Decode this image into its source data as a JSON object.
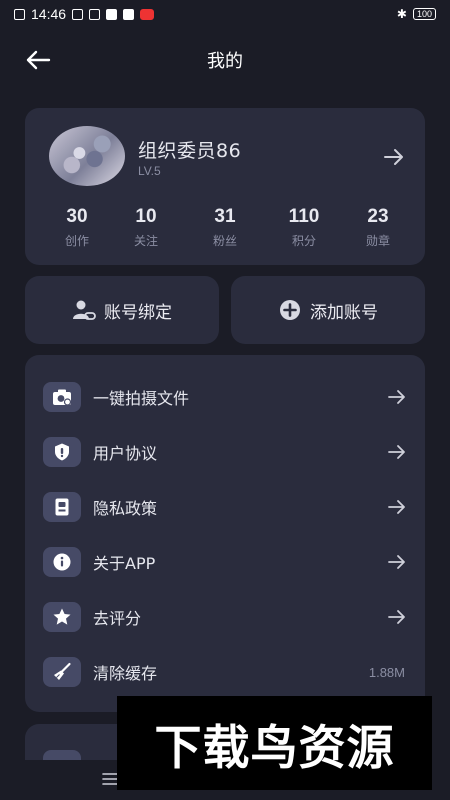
{
  "status_bar": {
    "time": "14:46",
    "battery": "100"
  },
  "header": {
    "title": "我的"
  },
  "profile": {
    "name": "组织委员86",
    "level": "LV.5",
    "stats": [
      {
        "value": "30",
        "label": "创作"
      },
      {
        "value": "10",
        "label": "关注"
      },
      {
        "value": "31",
        "label": "粉丝"
      },
      {
        "value": "110",
        "label": "积分"
      },
      {
        "value": "23",
        "label": "勋章"
      }
    ]
  },
  "actions": {
    "bind_account": "账号绑定",
    "add_account": "添加账号"
  },
  "menu": {
    "items": [
      {
        "label": "一键拍摄文件",
        "icon": "camera-icon"
      },
      {
        "label": "用户协议",
        "icon": "shield-icon"
      },
      {
        "label": "隐私政策",
        "icon": "document-icon"
      },
      {
        "label": "关于APP",
        "icon": "info-icon"
      },
      {
        "label": "去评分",
        "icon": "star-icon"
      },
      {
        "label": "清除缓存",
        "icon": "broom-icon",
        "value": "1.88M"
      }
    ]
  },
  "watermark": {
    "text": "下载鸟资源"
  },
  "colors": {
    "background": "#1b1c26",
    "card": "#2a2c3d",
    "icon_bg": "#464a66",
    "muted": "#8b8ea3"
  }
}
